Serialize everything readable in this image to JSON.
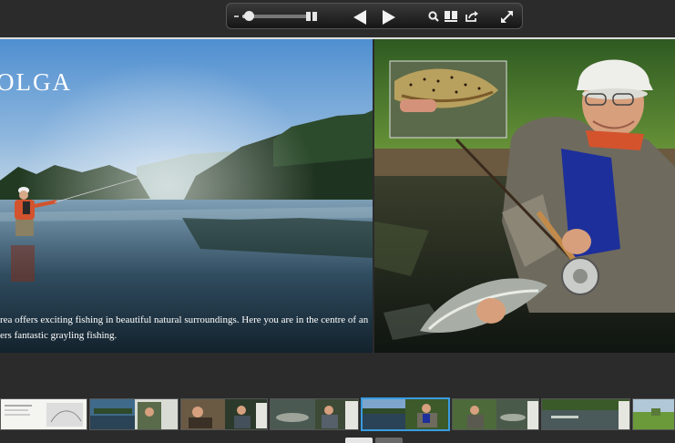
{
  "viewer": {
    "zoom": {
      "level": 0.1
    },
    "controls": {
      "zoom_out_icon": "minus-icon",
      "spread_view_icon": "double-page-icon",
      "previous_icon": "triangle-left-icon",
      "next_icon": "triangle-right-icon",
      "search_icon": "magnifier-icon",
      "pages_icon": "open-book-icon",
      "share_icon": "share-arrow-icon",
      "fullscreen_icon": "expand-arrows-icon"
    }
  },
  "spread": {
    "left_page": {
      "title": "OLGA",
      "caption_lines": [
        "rea offers exciting fishing in beautiful natural surroundings. Here you are in the centre of an",
        "ers fantastic grayling fishing."
      ]
    },
    "right_page": {
      "inset_photo": "trout-in-hands",
      "main_photo": "angler-holding-grayling"
    }
  },
  "thumbnails": [
    {
      "label": "page-2-3",
      "selected": false
    },
    {
      "label": "page-4-5",
      "selected": false
    },
    {
      "label": "page-6-7",
      "selected": false
    },
    {
      "label": "page-8-9",
      "selected": false
    },
    {
      "label": "page-10-11",
      "selected": true
    },
    {
      "label": "page-12-13",
      "selected": false
    },
    {
      "label": "page-14-15",
      "selected": false
    },
    {
      "label": "page-16-17",
      "selected": false
    }
  ],
  "colors": {
    "background": "#2b2b2b",
    "selection": "#3a9be0",
    "toolbar": "#1e1e1e"
  }
}
